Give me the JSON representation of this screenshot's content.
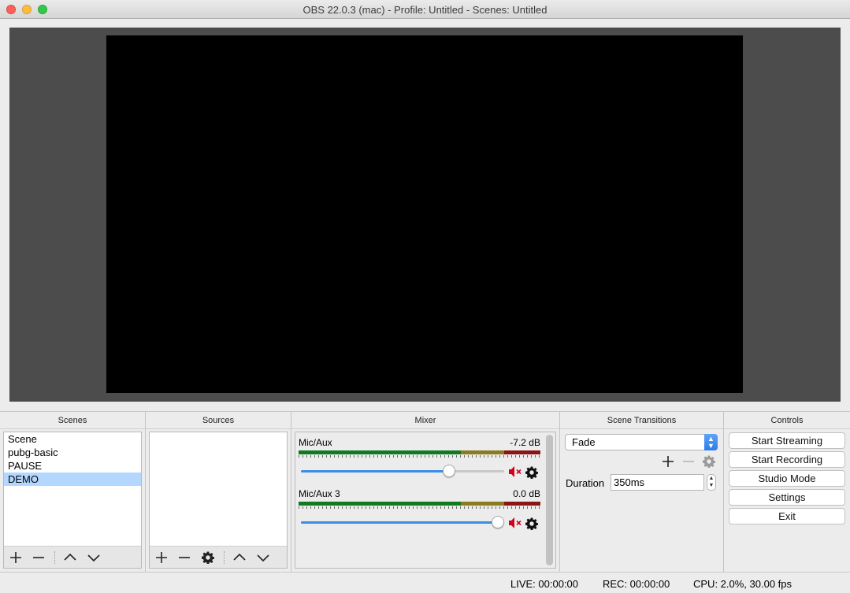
{
  "window": {
    "title": "OBS 22.0.3 (mac) - Profile: Untitled - Scenes: Untitled"
  },
  "scenes": {
    "title": "Scenes",
    "items": [
      "Scene",
      "pubg-basic",
      "PAUSE",
      "DEMO"
    ],
    "selected_index": 3
  },
  "sources": {
    "title": "Sources",
    "items": []
  },
  "mixer": {
    "title": "Mixer",
    "channels": [
      {
        "name": "Mic/Aux",
        "db": "-7.2 dB",
        "volume": 0.75,
        "muted": true
      },
      {
        "name": "Mic/Aux 3",
        "db": "0.0 dB",
        "volume": 1.0,
        "muted": true
      }
    ]
  },
  "transitions": {
    "title": "Scene Transitions",
    "selected": "Fade",
    "duration_label": "Duration",
    "duration_value": "350ms"
  },
  "controls": {
    "title": "Controls",
    "start_streaming": "Start Streaming",
    "start_recording": "Start Recording",
    "studio_mode": "Studio Mode",
    "settings": "Settings",
    "exit": "Exit"
  },
  "status": {
    "live": "LIVE: 00:00:00",
    "rec": "REC: 00:00:00",
    "cpu": "CPU: 2.0%, 30.00 fps"
  },
  "colors": {
    "mute_red": "#d0021b",
    "slider_blue": "#3b8de8",
    "selection": "#b3d7ff",
    "meter_green": "#0f7a1f",
    "meter_yellow": "#8c7a1f",
    "meter_red": "#8a1515"
  },
  "icons": [
    "plus-icon",
    "minus-icon",
    "chevron-up-icon",
    "chevron-down-icon",
    "gear-icon",
    "muted-speaker-icon"
  ]
}
